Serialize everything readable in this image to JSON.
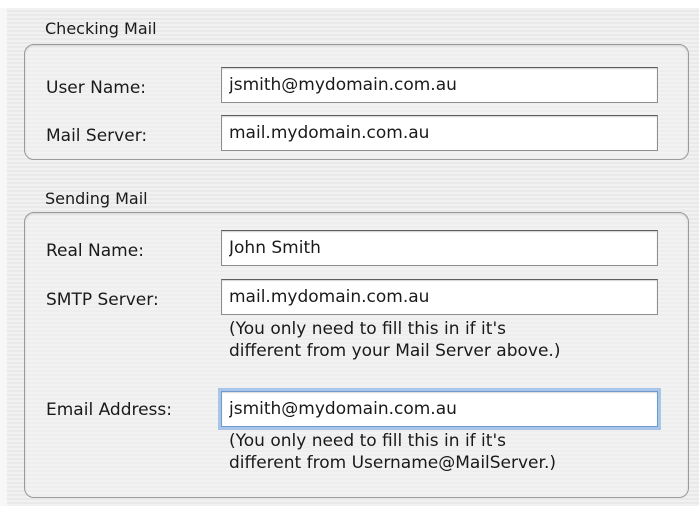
{
  "checking_mail": {
    "title": "Checking Mail",
    "user_name": {
      "label": "User Name:",
      "value": "jsmith@mydomain.com.au"
    },
    "mail_server": {
      "label": "Mail Server:",
      "value": "mail.mydomain.com.au"
    }
  },
  "sending_mail": {
    "title": "Sending Mail",
    "real_name": {
      "label": "Real Name:",
      "value": "John Smith"
    },
    "smtp_server": {
      "label": "SMTP Server:",
      "value": "mail.mydomain.com.au",
      "hint_line1": "(You only need to fill this in if it's",
      "hint_line2": "different from your Mail Server above.)"
    },
    "email_address": {
      "label": "Email Address:",
      "value": "jsmith@mydomain.com.au",
      "hint_line1": "(You only need to fill this in if it's",
      "hint_line2": "different from Username@MailServer.)"
    }
  },
  "colors": {
    "background_stripe_light": "#f1f1f1",
    "background_stripe_dark": "#e9e9e9",
    "focus_ring": "#a9c6ea",
    "box_border": "#9a9a9a"
  }
}
